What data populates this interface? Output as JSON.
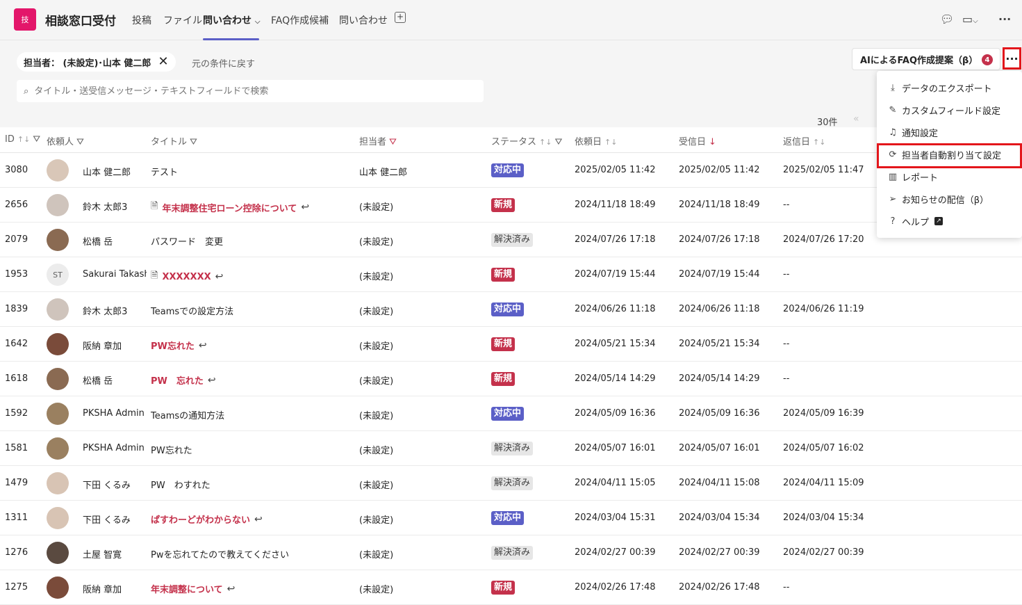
{
  "app": {
    "icon_text": "技",
    "title": "相談窓口受付",
    "tabs": [
      {
        "label": "投稿"
      },
      {
        "label": "ファイル"
      },
      {
        "label": "問い合わせ",
        "active": true
      },
      {
        "label": "FAQ作成候補"
      },
      {
        "label": "問い合わせ"
      }
    ],
    "add_tab": "+"
  },
  "filters": {
    "chip_label": "担当者： (未設定)･山本 健二郎",
    "chip_close": "✕",
    "reset_label": "元の条件に戻す",
    "search_placeholder": "タイトル・送受信メッセージ・テキストフィールドで検索"
  },
  "ai_button": {
    "label": "AIによるFAQ作成提案（β）",
    "badge": "4"
  },
  "more_button": "···",
  "count_label": "30件",
  "pager_prev": "«",
  "columns": {
    "id": "ID",
    "requester": "依頼人",
    "title": "タイトル",
    "assignee": "担当者",
    "status": "ステータス",
    "request_date": "依頼日",
    "received_date": "受信日",
    "reply_date": "返信日"
  },
  "rows": [
    {
      "id": "3080",
      "requester": "山本 健二郎",
      "avatar": "",
      "title": "テスト",
      "unread": false,
      "memo": false,
      "reply": false,
      "assignee": "山本 健二郎",
      "status": "対応中",
      "status_kind": "s-prog",
      "request_date": "2025/02/05 11:42",
      "received_date": "2025/02/05 11:42",
      "reply_date": "2025/02/05 11:47",
      "avatar_color": "#d9c7b8"
    },
    {
      "id": "2656",
      "requester": "鈴木 太郎3",
      "avatar": "",
      "title": "年末調整住宅ローン控除について",
      "unread": true,
      "memo": true,
      "reply": true,
      "assignee": "(未設定)",
      "status": "新規",
      "status_kind": "s-new",
      "request_date": "2024/11/18 18:49",
      "received_date": "2024/11/18 18:49",
      "reply_date": "--",
      "avatar_color": "#cfc4bc"
    },
    {
      "id": "2079",
      "requester": "松橋 岳",
      "avatar": "",
      "title": "パスワード　変更",
      "unread": false,
      "memo": false,
      "reply": false,
      "assignee": "(未設定)",
      "status": "解決済み",
      "status_kind": "s-done",
      "request_date": "2024/07/26 17:18",
      "received_date": "2024/07/26 17:18",
      "reply_date": "2024/07/26 17:20",
      "avatar_color": "#8a6a52"
    },
    {
      "id": "1953",
      "requester": "Sakurai Takash.",
      "avatar": "ST",
      "title": "XXXXXXX",
      "unread": true,
      "memo": true,
      "reply": true,
      "assignee": "(未設定)",
      "status": "新規",
      "status_kind": "s-new",
      "request_date": "2024/07/19 15:44",
      "received_date": "2024/07/19 15:44",
      "reply_date": "--",
      "avatar_color": "#ececec"
    },
    {
      "id": "1839",
      "requester": "鈴木 太郎3",
      "avatar": "",
      "title": "Teamsでの設定方法",
      "unread": false,
      "memo": false,
      "reply": false,
      "assignee": "(未設定)",
      "status": "対応中",
      "status_kind": "s-prog",
      "request_date": "2024/06/26 11:18",
      "received_date": "2024/06/26 11:18",
      "reply_date": "2024/06/26 11:19",
      "avatar_color": "#cfc4bc"
    },
    {
      "id": "1642",
      "requester": "阪納 章加",
      "avatar": "",
      "title": "PW忘れた",
      "unread": true,
      "memo": false,
      "reply": true,
      "assignee": "(未設定)",
      "status": "新規",
      "status_kind": "s-new",
      "request_date": "2024/05/21 15:34",
      "received_date": "2024/05/21 15:34",
      "reply_date": "--",
      "avatar_color": "#7a4b3a"
    },
    {
      "id": "1618",
      "requester": "松橋 岳",
      "avatar": "",
      "title": "PW　忘れた",
      "unread": true,
      "memo": false,
      "reply": true,
      "assignee": "(未設定)",
      "status": "新規",
      "status_kind": "s-new",
      "request_date": "2024/05/14 14:29",
      "received_date": "2024/05/14 14:29",
      "reply_date": "--",
      "avatar_color": "#8a6a52"
    },
    {
      "id": "1592",
      "requester": "PKSHA Admin",
      "avatar": "",
      "title": "Teamsの通知方法",
      "unread": false,
      "memo": false,
      "reply": false,
      "assignee": "(未設定)",
      "status": "対応中",
      "status_kind": "s-prog",
      "request_date": "2024/05/09 16:36",
      "received_date": "2024/05/09 16:36",
      "reply_date": "2024/05/09 16:39",
      "avatar_color": "#9a8060"
    },
    {
      "id": "1581",
      "requester": "PKSHA Admin",
      "avatar": "",
      "title": "PW忘れた",
      "unread": false,
      "memo": false,
      "reply": false,
      "assignee": "(未設定)",
      "status": "解決済み",
      "status_kind": "s-done",
      "request_date": "2024/05/07 16:01",
      "received_date": "2024/05/07 16:01",
      "reply_date": "2024/05/07 16:02",
      "avatar_color": "#9a8060"
    },
    {
      "id": "1479",
      "requester": "下田 くるみ",
      "avatar": "",
      "title": "PW　わすれた",
      "unread": false,
      "memo": false,
      "reply": false,
      "assignee": "(未設定)",
      "status": "解決済み",
      "status_kind": "s-done",
      "request_date": "2024/04/11 15:05",
      "received_date": "2024/04/11 15:08",
      "reply_date": "2024/04/11 15:09",
      "avatar_color": "#d8c4b4"
    },
    {
      "id": "1311",
      "requester": "下田 くるみ",
      "avatar": "",
      "title": "ぱすわーどがわからない",
      "unread": true,
      "memo": false,
      "reply": true,
      "assignee": "(未設定)",
      "status": "対応中",
      "status_kind": "s-prog",
      "request_date": "2024/03/04 15:31",
      "received_date": "2024/03/04 15:34",
      "reply_date": "2024/03/04 15:34",
      "avatar_color": "#d8c4b4"
    },
    {
      "id": "1276",
      "requester": "土屋 智寛",
      "avatar": "",
      "title": "Pwを忘れてたので教えてください",
      "unread": false,
      "memo": false,
      "reply": false,
      "assignee": "(未設定)",
      "status": "解決済み",
      "status_kind": "s-done",
      "request_date": "2024/02/27 00:39",
      "received_date": "2024/02/27 00:39",
      "reply_date": "2024/02/27 00:39",
      "avatar_color": "#5a4a40"
    },
    {
      "id": "1275",
      "requester": "阪納 章加",
      "avatar": "",
      "title": "年末調整について",
      "unread": true,
      "memo": false,
      "reply": true,
      "assignee": "(未設定)",
      "status": "新規",
      "status_kind": "s-new",
      "request_date": "2024/02/26 17:48",
      "received_date": "2024/02/26 17:48",
      "reply_date": "--",
      "avatar_color": "#7a4b3a"
    }
  ],
  "menu": {
    "items": [
      {
        "label": "データのエクスポート",
        "icon": "download-icon",
        "glyph": "⤓"
      },
      {
        "label": "カスタムフィールド設定",
        "icon": "edit-form-icon",
        "glyph": "✎"
      },
      {
        "label": "通知設定",
        "icon": "bell-icon",
        "glyph": "♫"
      },
      {
        "label": "担当者自動割り当て設定",
        "icon": "person-sync-icon",
        "glyph": "⟳"
      },
      {
        "label": "レポート",
        "icon": "bar-chart-icon",
        "glyph": "▥"
      },
      {
        "label": "お知らせの配信（β）",
        "icon": "send-icon",
        "glyph": "➢"
      },
      {
        "label": "ヘルプ",
        "icon": "help-icon",
        "glyph": "?"
      }
    ]
  },
  "colors": {
    "accent": "#5b5fc7",
    "brand": "#e3166a",
    "alert": "#c4314b",
    "highlight": "#e3161b"
  }
}
